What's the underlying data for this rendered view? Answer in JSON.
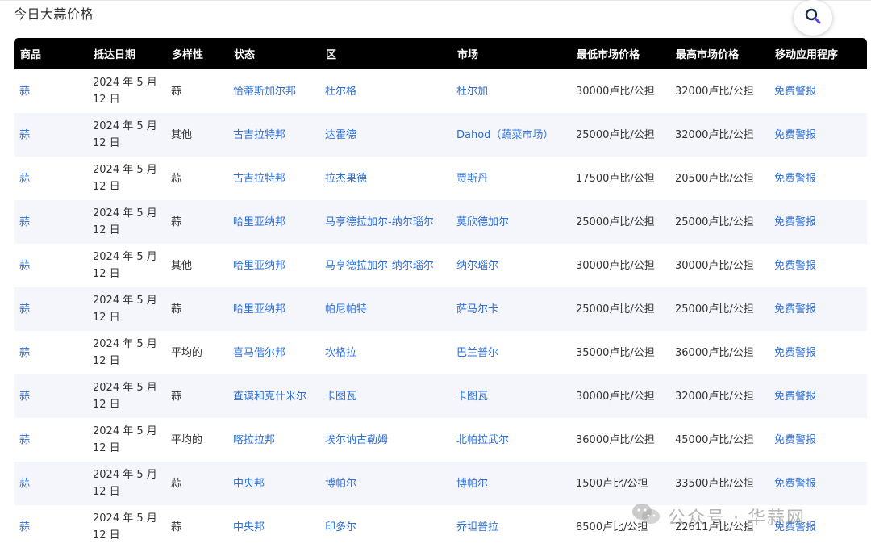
{
  "page": {
    "title": "今日大蒜价格"
  },
  "search": {
    "icon": "search-icon"
  },
  "table": {
    "headers": [
      "商品",
      "抵达日期",
      "多样性",
      "状态",
      "区",
      "市场",
      "最低市场价格",
      "最高市场价格",
      "移动应用程序"
    ],
    "rows": [
      [
        "蒜",
        "2024 年 5 月 12 日",
        "蒜",
        "恰蒂斯加尔邦",
        "杜尔格",
        "杜尔加",
        "30000卢比/公担",
        "32000卢比/公担",
        "免费警报"
      ],
      [
        "蒜",
        "2024 年 5 月 12 日",
        "其他",
        "古吉拉特邦",
        "达霍德",
        "Dahod（蔬菜市场）",
        "25000卢比/公担",
        "32000卢比/公担",
        "免费警报"
      ],
      [
        "蒜",
        "2024 年 5 月 12 日",
        "蒜",
        "古吉拉特邦",
        "拉杰果德",
        "贾斯丹",
        "17500卢比/公担",
        "20500卢比/公担",
        "免费警报"
      ],
      [
        "蒜",
        "2024 年 5 月 12 日",
        "蒜",
        "哈里亚纳邦",
        "马亨德拉加尔-纳尔瑙尔",
        "莫欣德加尔",
        "25000卢比/公担",
        "25000卢比/公担",
        "免费警报"
      ],
      [
        "蒜",
        "2024 年 5 月 12 日",
        "其他",
        "哈里亚纳邦",
        "马亨德拉加尔-纳尔瑙尔",
        "纳尔瑙尔",
        "30000卢比/公担",
        "30000卢比/公担",
        "免费警报"
      ],
      [
        "蒜",
        "2024 年 5 月 12 日",
        "蒜",
        "哈里亚纳邦",
        "帕尼帕特",
        "萨马尔卡",
        "25000卢比/公担",
        "25000卢比/公担",
        "免费警报"
      ],
      [
        "蒜",
        "2024 年 5 月 12 日",
        "平均的",
        "喜马偕尔邦",
        "坎格拉",
        "巴兰普尔",
        "35000卢比/公担",
        "36000卢比/公担",
        "免费警报"
      ],
      [
        "蒜",
        "2024 年 5 月 12 日",
        "蒜",
        "查谟和克什米尔",
        "卡图瓦",
        "卡图瓦",
        "30000卢比/公担",
        "32000卢比/公担",
        "免费警报"
      ],
      [
        "蒜",
        "2024 年 5 月 12 日",
        "平均的",
        "喀拉拉邦",
        "埃尔讷古勒姆",
        "北帕拉武尔",
        "36000卢比/公担",
        "45000卢比/公担",
        "免费警报"
      ],
      [
        "蒜",
        "2024 年 5 月 12 日",
        "蒜",
        "中央邦",
        "博帕尔",
        "博帕尔",
        "1500卢比/公担",
        "33500卢比/公担",
        "免费警报"
      ],
      [
        "蒜",
        "2024 年 5 月 12 日",
        "蒜",
        "中央邦",
        "印多尔",
        "乔坦普拉",
        "8500卢比/公担",
        "22611卢比/公担",
        "免费警报"
      ]
    ]
  },
  "watermark": {
    "text": "公众号 · 华蒜网",
    "icon": "wechat-icon"
  },
  "colors": {
    "link": "#2d6fd6",
    "header_bg": "#000000",
    "stripe": "#f5f6fb"
  }
}
